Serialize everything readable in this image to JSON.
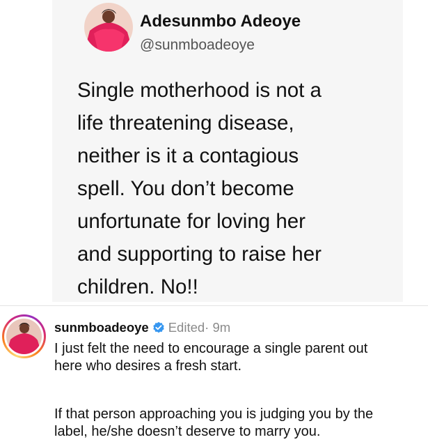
{
  "tweet": {
    "author_name": "Adesunmbo Adeoye",
    "author_handle": "@sunmboadeoye",
    "body_lines": [
      "Single motherhood is not a",
      "life threatening disease,",
      "neither is it a contagious",
      "spell. You don’t become",
      "unfortunate for loving her",
      "and supporting to raise her",
      "children. No!!"
    ]
  },
  "caption": {
    "username": "sunmboadeoye",
    "verified_icon": "verified-badge-icon",
    "edited_label": "Edited",
    "time": " · 9m",
    "paragraph_1_lines": [
      "I just felt the need to encourage a single parent out",
      "here who desires a fresh start."
    ],
    "paragraph_2_lines": [
      "If that person approaching you is judging you by the",
      "label, he/she doesn’t deserve to marry you."
    ]
  },
  "colors": {
    "tweet_card_bg": "#f6f6f6",
    "verified_blue": "#3797f0",
    "muted_text": "#8a8a8a",
    "avatar_dress": "#e0205a"
  }
}
